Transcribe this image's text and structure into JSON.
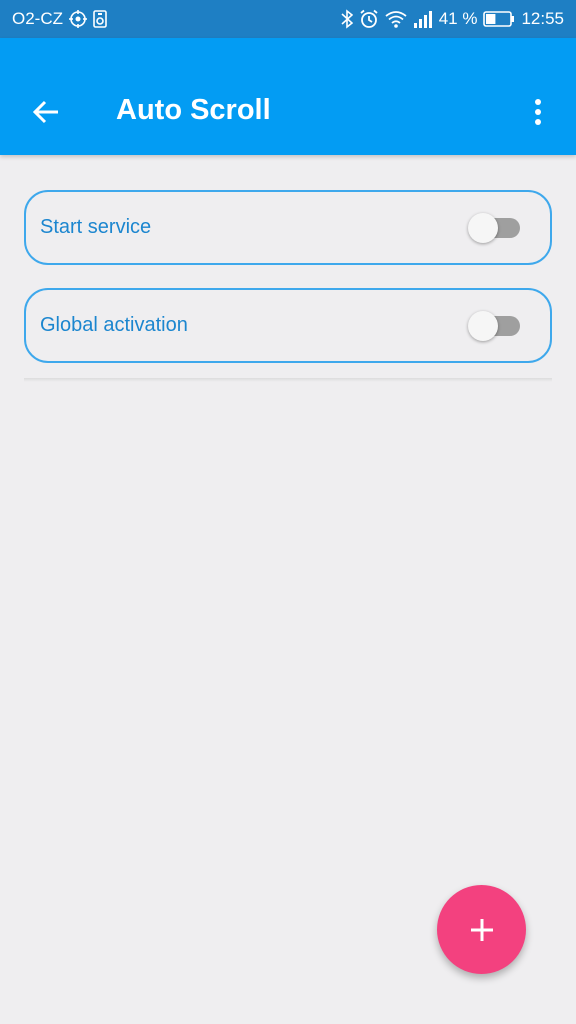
{
  "status_bar": {
    "carrier": "O2-CZ",
    "battery_percent": "41 %",
    "time": "12:55",
    "icons": [
      "location-icon",
      "sd-card-icon",
      "bluetooth-icon",
      "alarm-icon",
      "wifi-icon",
      "signal-icon",
      "battery-icon"
    ],
    "battery_level": 0.41
  },
  "app_bar": {
    "title": "Auto Scroll",
    "back_icon": "back-arrow-icon",
    "menu_icon": "more-vert-icon"
  },
  "settings": [
    {
      "label": "Start service",
      "enabled": false
    },
    {
      "label": "Global activation",
      "enabled": false
    }
  ],
  "fab": {
    "icon": "plus-icon"
  },
  "colors": {
    "status_bar": "#1e7fc4",
    "app_bar": "#039cf3",
    "card_border": "#3ea8ec",
    "card_text": "#1c86cf",
    "fab": "#f3417f",
    "background": "#efeef0"
  }
}
